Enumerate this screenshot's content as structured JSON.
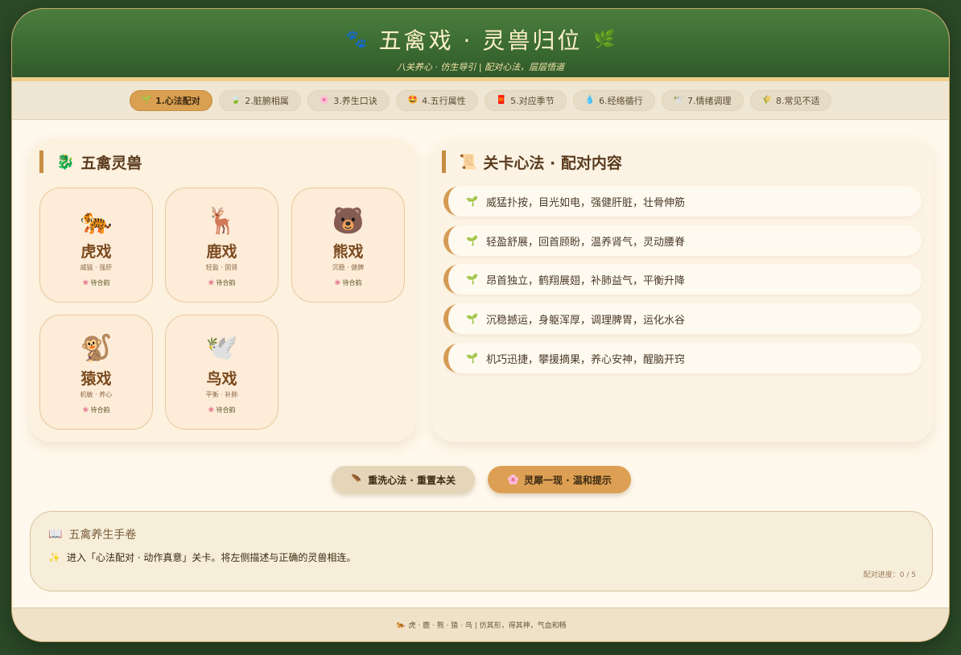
{
  "header": {
    "title": "五禽戏 · 灵兽归位",
    "title_icon_left": "🐾",
    "title_icon_right": "🌿",
    "subtitle": "八关养心 · 仿生导引 | 配对心法，层层悟道"
  },
  "tabs": [
    {
      "icon": "🌱",
      "label": "1.心法配对",
      "active": true
    },
    {
      "icon": "🍃",
      "label": "2.脏腑相属",
      "active": false
    },
    {
      "icon": "🌸",
      "label": "3.养生口诀",
      "active": false
    },
    {
      "icon": "🤩",
      "label": "4.五行属性",
      "active": false
    },
    {
      "icon": "🧧",
      "label": "5.对应季节",
      "active": false
    },
    {
      "icon": "💧",
      "label": "6.经络循行",
      "active": false
    },
    {
      "icon": "🕊️",
      "label": "7.情绪调理",
      "active": false
    },
    {
      "icon": "🌾",
      "label": "8.常见不适",
      "active": false
    }
  ],
  "left_panel": {
    "icon": "🐉",
    "title": "五禽灵兽",
    "cards": [
      {
        "emoji": "🐅",
        "name": "虎戏",
        "desc": "威猛 · 强肝",
        "status": "待合韵"
      },
      {
        "emoji": "🦌",
        "name": "鹿戏",
        "desc": "轻盈 · 固肾",
        "status": "待合韵"
      },
      {
        "emoji": "🐻",
        "name": "熊戏",
        "desc": "沉稳 · 健脾",
        "status": "待合韵"
      },
      {
        "emoji": "🐒",
        "name": "猿戏",
        "desc": "机敏 · 养心",
        "status": "待合韵"
      },
      {
        "emoji": "🕊️",
        "name": "鸟戏",
        "desc": "平衡 · 补肺",
        "status": "待合韵"
      }
    ],
    "status_dot": "❀"
  },
  "right_panel": {
    "icon": "📜",
    "title": "关卡心法 · 配对内容",
    "sprout_icon": "🌱",
    "items": [
      "威猛扑按，目光如电，强健肝脏，壮骨伸筋",
      "轻盈舒展，回首顾盼，温养肾气，灵动腰脊",
      "昂首独立，鹤翔展翅，补肺益气，平衡升降",
      "沉稳撼运，身躯浑厚，调理脾胃，运化水谷",
      "机巧迅捷，攀援摘果，养心安神，醒脑开窍"
    ]
  },
  "buttons": {
    "reset_icon": "🪶",
    "reset_label": "重洗心法 · 重置本关",
    "hint_icon": "🌸",
    "hint_label": "灵犀一现 · 温和提示"
  },
  "manual": {
    "icon": "📖",
    "title": "五禽养生手卷",
    "text_icon": "✨",
    "text": "进入「心法配对 · 动作真意」关卡。将左侧描述与正确的灵兽相连。",
    "progress": "配对进度：0 / 5"
  },
  "footer": {
    "icon": "🐅",
    "text": "虎 · 鹿 · 熊 · 猿 · 鸟 | 仿其形，得其神，气血和畅"
  }
}
